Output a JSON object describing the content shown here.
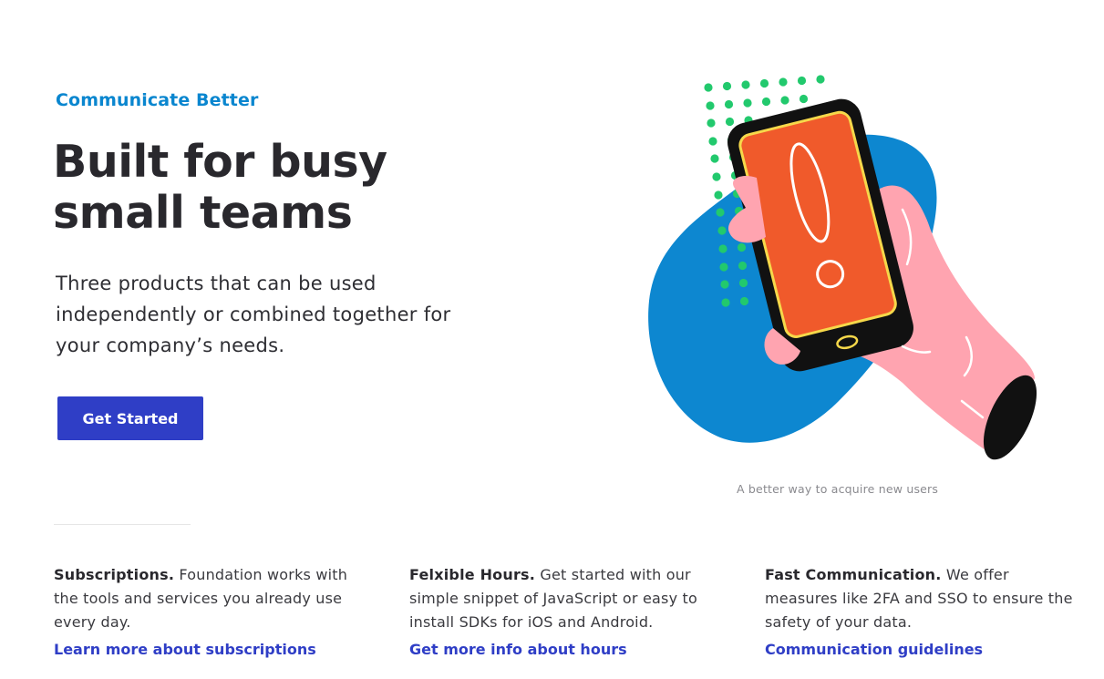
{
  "hero": {
    "eyebrow": "Communicate Better",
    "headline": "Built for busy small teams",
    "lead": "Three products that can be used independently or combined together for your company’s needs.",
    "cta_label": "Get Started"
  },
  "illustration": {
    "caption": "A better way to acquire new users",
    "colors": {
      "blob": "#0d87d0",
      "dots": "#22c96d",
      "phone_screen": "#f05a2b",
      "phone_body": "#111111",
      "screen_outline": "#f6d84a",
      "hand": "#ffa4b0"
    }
  },
  "features": [
    {
      "title": "Subscriptions.",
      "text": "Foundation works with the tools and services you already use every day.",
      "link": "Learn more about subscriptions"
    },
    {
      "title": "Felxible Hours.",
      "text": "Get started with our simple snippet of JavaScript or easy to install SDKs for iOS and Android.",
      "link": "Get more info about hours"
    },
    {
      "title": "Fast Communication.",
      "text": "We offer measures like 2FA and SSO to ensure the safety of your data.",
      "link": "Communication guidelines"
    }
  ],
  "colors": {
    "accent": "#0a86cf",
    "primary_button": "#2f3ec6",
    "heading": "#29282d"
  }
}
